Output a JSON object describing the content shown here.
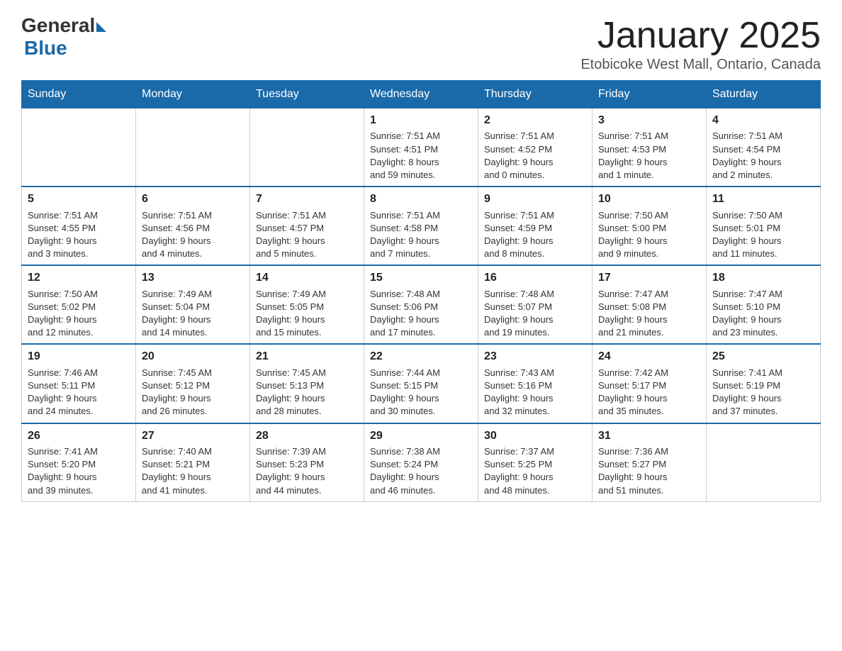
{
  "logo": {
    "general": "General",
    "blue": "Blue"
  },
  "title": "January 2025",
  "location": "Etobicoke West Mall, Ontario, Canada",
  "weekdays": [
    "Sunday",
    "Monday",
    "Tuesday",
    "Wednesday",
    "Thursday",
    "Friday",
    "Saturday"
  ],
  "weeks": [
    [
      {
        "day": "",
        "info": ""
      },
      {
        "day": "",
        "info": ""
      },
      {
        "day": "",
        "info": ""
      },
      {
        "day": "1",
        "info": "Sunrise: 7:51 AM\nSunset: 4:51 PM\nDaylight: 8 hours\nand 59 minutes."
      },
      {
        "day": "2",
        "info": "Sunrise: 7:51 AM\nSunset: 4:52 PM\nDaylight: 9 hours\nand 0 minutes."
      },
      {
        "day": "3",
        "info": "Sunrise: 7:51 AM\nSunset: 4:53 PM\nDaylight: 9 hours\nand 1 minute."
      },
      {
        "day": "4",
        "info": "Sunrise: 7:51 AM\nSunset: 4:54 PM\nDaylight: 9 hours\nand 2 minutes."
      }
    ],
    [
      {
        "day": "5",
        "info": "Sunrise: 7:51 AM\nSunset: 4:55 PM\nDaylight: 9 hours\nand 3 minutes."
      },
      {
        "day": "6",
        "info": "Sunrise: 7:51 AM\nSunset: 4:56 PM\nDaylight: 9 hours\nand 4 minutes."
      },
      {
        "day": "7",
        "info": "Sunrise: 7:51 AM\nSunset: 4:57 PM\nDaylight: 9 hours\nand 5 minutes."
      },
      {
        "day": "8",
        "info": "Sunrise: 7:51 AM\nSunset: 4:58 PM\nDaylight: 9 hours\nand 7 minutes."
      },
      {
        "day": "9",
        "info": "Sunrise: 7:51 AM\nSunset: 4:59 PM\nDaylight: 9 hours\nand 8 minutes."
      },
      {
        "day": "10",
        "info": "Sunrise: 7:50 AM\nSunset: 5:00 PM\nDaylight: 9 hours\nand 9 minutes."
      },
      {
        "day": "11",
        "info": "Sunrise: 7:50 AM\nSunset: 5:01 PM\nDaylight: 9 hours\nand 11 minutes."
      }
    ],
    [
      {
        "day": "12",
        "info": "Sunrise: 7:50 AM\nSunset: 5:02 PM\nDaylight: 9 hours\nand 12 minutes."
      },
      {
        "day": "13",
        "info": "Sunrise: 7:49 AM\nSunset: 5:04 PM\nDaylight: 9 hours\nand 14 minutes."
      },
      {
        "day": "14",
        "info": "Sunrise: 7:49 AM\nSunset: 5:05 PM\nDaylight: 9 hours\nand 15 minutes."
      },
      {
        "day": "15",
        "info": "Sunrise: 7:48 AM\nSunset: 5:06 PM\nDaylight: 9 hours\nand 17 minutes."
      },
      {
        "day": "16",
        "info": "Sunrise: 7:48 AM\nSunset: 5:07 PM\nDaylight: 9 hours\nand 19 minutes."
      },
      {
        "day": "17",
        "info": "Sunrise: 7:47 AM\nSunset: 5:08 PM\nDaylight: 9 hours\nand 21 minutes."
      },
      {
        "day": "18",
        "info": "Sunrise: 7:47 AM\nSunset: 5:10 PM\nDaylight: 9 hours\nand 23 minutes."
      }
    ],
    [
      {
        "day": "19",
        "info": "Sunrise: 7:46 AM\nSunset: 5:11 PM\nDaylight: 9 hours\nand 24 minutes."
      },
      {
        "day": "20",
        "info": "Sunrise: 7:45 AM\nSunset: 5:12 PM\nDaylight: 9 hours\nand 26 minutes."
      },
      {
        "day": "21",
        "info": "Sunrise: 7:45 AM\nSunset: 5:13 PM\nDaylight: 9 hours\nand 28 minutes."
      },
      {
        "day": "22",
        "info": "Sunrise: 7:44 AM\nSunset: 5:15 PM\nDaylight: 9 hours\nand 30 minutes."
      },
      {
        "day": "23",
        "info": "Sunrise: 7:43 AM\nSunset: 5:16 PM\nDaylight: 9 hours\nand 32 minutes."
      },
      {
        "day": "24",
        "info": "Sunrise: 7:42 AM\nSunset: 5:17 PM\nDaylight: 9 hours\nand 35 minutes."
      },
      {
        "day": "25",
        "info": "Sunrise: 7:41 AM\nSunset: 5:19 PM\nDaylight: 9 hours\nand 37 minutes."
      }
    ],
    [
      {
        "day": "26",
        "info": "Sunrise: 7:41 AM\nSunset: 5:20 PM\nDaylight: 9 hours\nand 39 minutes."
      },
      {
        "day": "27",
        "info": "Sunrise: 7:40 AM\nSunset: 5:21 PM\nDaylight: 9 hours\nand 41 minutes."
      },
      {
        "day": "28",
        "info": "Sunrise: 7:39 AM\nSunset: 5:23 PM\nDaylight: 9 hours\nand 44 minutes."
      },
      {
        "day": "29",
        "info": "Sunrise: 7:38 AM\nSunset: 5:24 PM\nDaylight: 9 hours\nand 46 minutes."
      },
      {
        "day": "30",
        "info": "Sunrise: 7:37 AM\nSunset: 5:25 PM\nDaylight: 9 hours\nand 48 minutes."
      },
      {
        "day": "31",
        "info": "Sunrise: 7:36 AM\nSunset: 5:27 PM\nDaylight: 9 hours\nand 51 minutes."
      },
      {
        "day": "",
        "info": ""
      }
    ]
  ]
}
